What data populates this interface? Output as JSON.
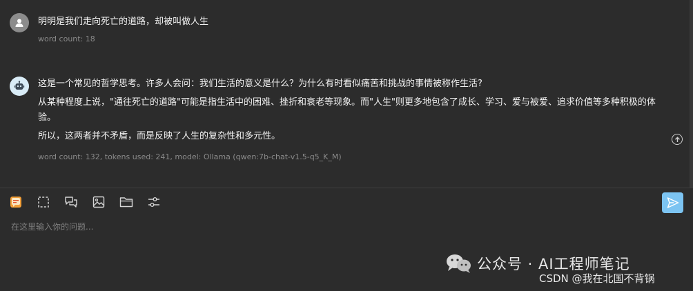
{
  "messages": [
    {
      "role": "user",
      "text": "明明是我们走向死亡的道路，却被叫做人生",
      "meta": "word count: 18"
    },
    {
      "role": "assistant",
      "paragraphs": [
        "这是一个常见的哲学思考。许多人会问：我们生活的意义是什么？为什么有时看似痛苦和挑战的事情被称作生活?",
        "从某种程度上说，\"通往死亡的道路\"可能是指生活中的困难、挫折和衰老等现象。而\"人生\"则更多地包含了成长、学习、爱与被爱、追求价值等多种积极的体验。",
        "所以，这两者并不矛盾，而是反映了人生的复杂性和多元性。"
      ],
      "meta": "word count: 132, tokens used: 241, model: Ollama (qwen:7b-chat-v1.5-q5_K_M)"
    }
  ],
  "input": {
    "placeholder": "在这里输入你的问题...",
    "value": ""
  },
  "toolbar": {
    "icons": [
      "chat-mode-icon",
      "screenshot-select-icon",
      "conversation-icon",
      "image-icon",
      "folder-icon",
      "settings-sliders-icon"
    ]
  },
  "watermark": {
    "main": "公众号 · AI工程师笔记",
    "sub": "CSDN @我在北国不背锅"
  },
  "colors": {
    "background": "#2c2c2c",
    "accent_send": "#7cc4f2",
    "meta_text": "#8a8a8a"
  }
}
